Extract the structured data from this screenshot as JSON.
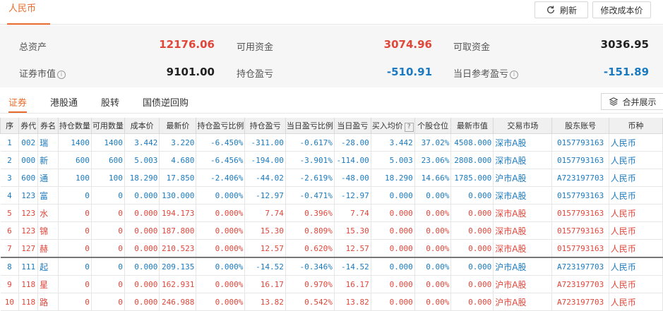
{
  "header": {
    "currency_tab": "人民币",
    "refresh_label": "刷新",
    "edit_cost_label": "修改成本价"
  },
  "summary": {
    "total_assets_label": "总资产",
    "total_assets": "12176.06",
    "available_label": "可用资金",
    "available": "3074.96",
    "withdrawable_label": "可取资金",
    "withdrawable": "3036.95",
    "market_value_label": "证券市值",
    "market_value": "9101.00",
    "position_pl_label": "持仓盈亏",
    "position_pl": "-510.91",
    "daily_pl_label": "当日参考盈亏",
    "daily_pl": "-151.89"
  },
  "tabs": [
    "证券",
    "港股通",
    "股转",
    "国债逆回购"
  ],
  "merge_label": "合并展示",
  "colors": {
    "accent": "#e86b2b",
    "up": "#e0463a",
    "down": "#1b7abf"
  },
  "table": {
    "headers": [
      "序",
      "券代",
      "券名",
      "持仓数量",
      "可用数量",
      "成本价",
      "最新价",
      "持仓盈亏比例",
      "持仓盈亏",
      "当日盈亏比例",
      "当日盈亏",
      "买入均价",
      "个股仓位",
      "最新市值",
      "交易市场",
      "股东账号",
      "币种"
    ],
    "rows": [
      {
        "c": [
          "1",
          "002",
          "瑞",
          "1400",
          "1400",
          "3.442",
          "3.220",
          "-6.450%",
          "-311.00",
          "-0.617%",
          "-28.00",
          "3.442",
          "37.02%",
          "4508.000",
          "深市A股",
          "0157793163",
          "人民币"
        ],
        "dir": "down"
      },
      {
        "c": [
          "2",
          "000",
          "新",
          "600",
          "600",
          "5.003",
          "4.680",
          "-6.456%",
          "-194.00",
          "-3.901%",
          "-114.00",
          "5.003",
          "23.06%",
          "2808.000",
          "深市A股",
          "0157793163",
          "人民币"
        ],
        "dir": "down"
      },
      {
        "c": [
          "3",
          "600",
          "通",
          "100",
          "100",
          "18.290",
          "17.850",
          "-2.406%",
          "-44.02",
          "-2.619%",
          "-48.00",
          "18.290",
          "14.66%",
          "1785.000",
          "沪市A股",
          "A723197703",
          "人民币"
        ],
        "dir": "down"
      },
      {
        "c": [
          "4",
          "123",
          "富",
          "0",
          "0",
          "0.000",
          "130.000",
          "0.000%",
          "-12.97",
          "-0.471%",
          "-12.97",
          "0.000",
          "0.00%",
          "0.000",
          "深市A股",
          "0157793163",
          "人民币"
        ],
        "dir": "down"
      },
      {
        "c": [
          "5",
          "123",
          "水",
          "0",
          "0",
          "0.000",
          "194.173",
          "0.000%",
          "7.74",
          "0.396%",
          "7.74",
          "0.000",
          "0.00%",
          "0.000",
          "深市A股",
          "0157793163",
          "人民币"
        ],
        "dir": "up"
      },
      {
        "c": [
          "6",
          "123",
          "锦",
          "0",
          "0",
          "0.000",
          "187.800",
          "0.000%",
          "15.30",
          "0.809%",
          "15.30",
          "0.000",
          "0.00%",
          "0.000",
          "深市A股",
          "0157793163",
          "人民币"
        ],
        "dir": "up"
      },
      {
        "c": [
          "7",
          "127",
          "赫",
          "0",
          "0",
          "0.000",
          "210.523",
          "0.000%",
          "12.57",
          "0.620%",
          "12.57",
          "0.000",
          "0.00%",
          "0.000",
          "深市A股",
          "0157793163",
          "人民币"
        ],
        "dir": "up"
      },
      {
        "c": [
          "8",
          "111",
          "起",
          "0",
          "0",
          "0.000",
          "209.135",
          "0.000%",
          "-14.52",
          "-0.346%",
          "-14.52",
          "0.000",
          "0.00%",
          "0.000",
          "沪市A股",
          "A723197703",
          "人民币"
        ],
        "dir": "down"
      },
      {
        "c": [
          "9",
          "118",
          "星",
          "0",
          "0",
          "0.000",
          "162.931",
          "0.000%",
          "16.17",
          "0.970%",
          "16.17",
          "0.000",
          "0.00%",
          "0.000",
          "沪市A股",
          "A723197703",
          "人民币"
        ],
        "dir": "up"
      },
      {
        "c": [
          "10",
          "118",
          "路",
          "0",
          "0",
          "0.000",
          "246.988",
          "0.000%",
          "13.82",
          "0.542%",
          "13.82",
          "0.000",
          "0.00%",
          "0.000",
          "沪市A股",
          "A723197703",
          "人民币"
        ],
        "dir": "up"
      }
    ]
  }
}
